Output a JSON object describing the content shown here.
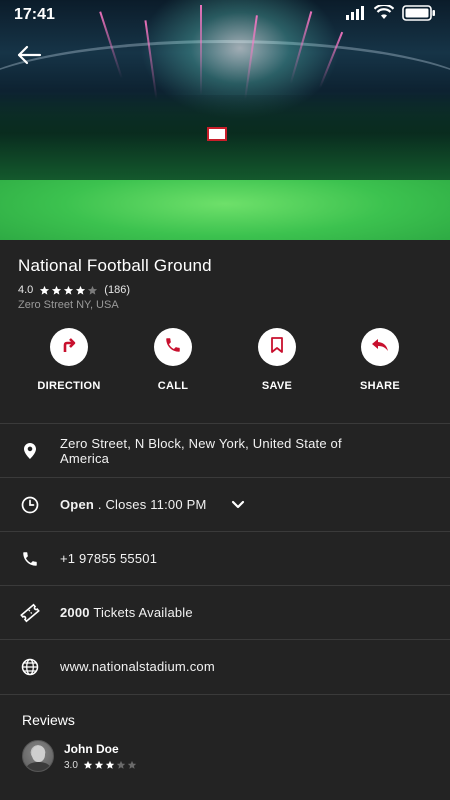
{
  "status": {
    "time": "17:41"
  },
  "place": {
    "title": "National Football Ground",
    "rating": "4.0",
    "stars_filled": 4,
    "stars_total": 5,
    "review_count": "(186)",
    "subtitle_address": "Zero Street NY, USA"
  },
  "actions": [
    {
      "label": "DIRECTION",
      "icon": "direction-icon"
    },
    {
      "label": "CALL",
      "icon": "phone-icon"
    },
    {
      "label": "SAVE",
      "icon": "bookmark-icon"
    },
    {
      "label": "SHARE",
      "icon": "share-icon"
    }
  ],
  "info": {
    "address_line1": "Zero Street, N Block, New York, United State of",
    "address_line2": "America",
    "hours_status": "Open",
    "hours_detail": ". Closes 11:00 PM",
    "phone": "+1 97855 55501",
    "tickets_count": "2000",
    "tickets_label": "Tickets Available",
    "website": "www.nationalstadium.com"
  },
  "reviews": {
    "heading": "Reviews",
    "items": [
      {
        "name": "John Doe",
        "rating": "3.0",
        "stars_filled": 3,
        "stars_total": 5
      }
    ]
  },
  "colors": {
    "accent": "#c8102e",
    "background": "#232323",
    "divider": "#3a3a3a"
  }
}
